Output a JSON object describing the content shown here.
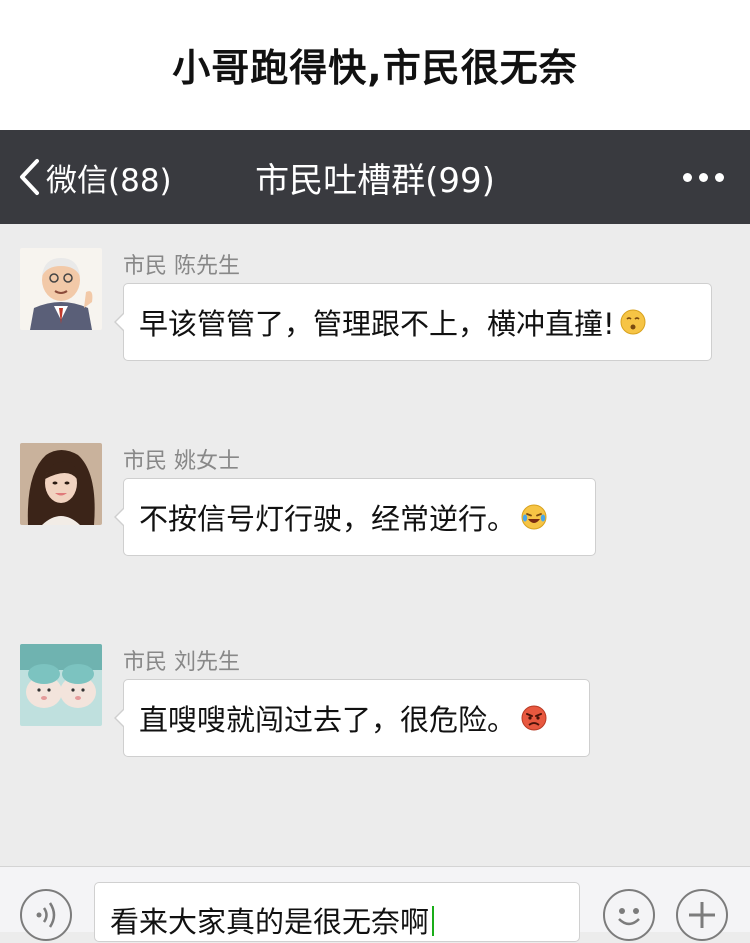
{
  "banner": {
    "title": "小哥跑得快,市民很无奈"
  },
  "navbar": {
    "back_label": "微信(88)",
    "title": "市民吐槽群(99)",
    "more_icon": "more-dots-icon"
  },
  "messages": [
    {
      "sender": "市民 陈先生",
      "text": "早该管管了，管理跟不上，横冲直撞!",
      "emoji": "dizzy-face-emoji",
      "avatar": "cartoon-old-man-avatar"
    },
    {
      "sender": "市民 姚女士",
      "text": "不按信号灯行驶，经常逆行。",
      "emoji": "tears-of-joy-emoji",
      "avatar": "young-woman-photo-avatar"
    },
    {
      "sender": "市民 刘先生",
      "text": "直嗖嗖就闯过去了，很危险。",
      "emoji": "angry-face-emoji",
      "avatar": "two-rats-photo-avatar"
    }
  ],
  "input": {
    "value": "看来大家真的是很无奈啊",
    "voice_icon": "voice-icon",
    "emoji_icon": "smiley-icon",
    "plus_icon": "plus-icon"
  },
  "colors": {
    "navbar": "#393a3f",
    "chat_bg": "#ececec",
    "caret": "#1aad19"
  }
}
